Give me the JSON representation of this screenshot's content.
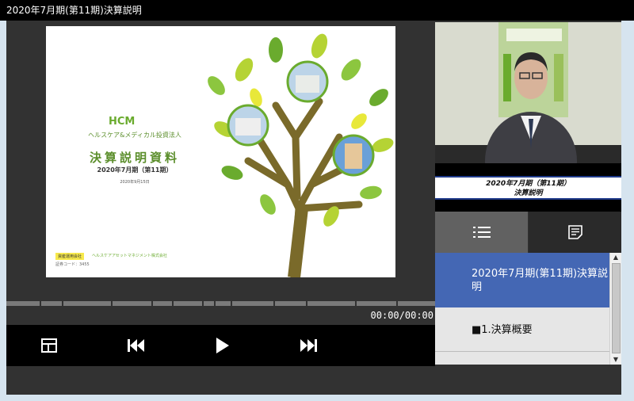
{
  "window": {
    "title": "2020年7月期(第11期)決算説明"
  },
  "slide": {
    "logo": "HCM",
    "corp_name": "ヘルスケア&メディカル投資法人",
    "doc_title": "決算説明資料",
    "period": "2020年7月期（第11期）",
    "date": "2020年9月15日",
    "footer_badge": "資産運用会社",
    "footer_corp": "ヘルスケアアセットマネジメント株式会社",
    "footer_code": "証券コード：3455"
  },
  "player": {
    "time": "00:00/00:00",
    "progress": 0,
    "colors": {
      "progress_fill": "#3e80c2",
      "progress_track": "#7a7a7a"
    }
  },
  "controls": {
    "layout_icon": "layout-icon",
    "prev_icon": "skip-previous-icon",
    "play_icon": "play-icon",
    "next_icon": "skip-next-icon"
  },
  "video": {
    "caption_line1": "2020年7月期（第11期）",
    "caption_line2": "決算説明"
  },
  "tabs": {
    "chapters_icon": "list-icon",
    "notes_icon": "notes-icon"
  },
  "chapters": [
    {
      "label": "2020年7月期(第11期)決算説明"
    },
    {
      "label": "■1.決算概要"
    }
  ],
  "colors": {
    "accent_selected": "#4467b4",
    "brand_green": "#6aab2e"
  }
}
